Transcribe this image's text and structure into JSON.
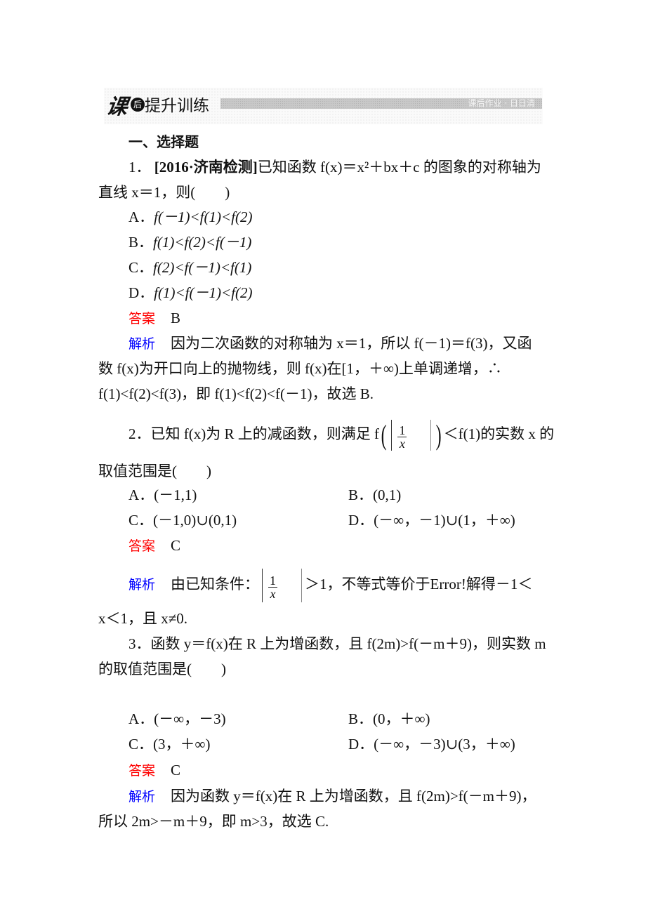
{
  "header": {
    "logo_char": "课",
    "badge_char": "后",
    "title": "提升训练",
    "subtitle": "课后作业 · 日日清"
  },
  "section_title": "一、选择题",
  "colors": {
    "answer_label": "#ff0000",
    "analysis_label": "#0000ff",
    "text": "#111111"
  },
  "questions": [
    {
      "number": "1．",
      "stem_line1_prefix": "[2016·济南检测]",
      "stem_line1_rest": "已知函数 f(x)＝x²＋bx＋c 的图象的对称轴为",
      "stem_line2": "直线 x＝1，则(　　)",
      "options": [
        {
          "label": "A．",
          "text": "f(－1)<f(1)<f(2)"
        },
        {
          "label": "B．",
          "text": "f(1)<f(2)<f(－1)"
        },
        {
          "label": "C．",
          "text": "f(2)<f(－1)<f(1)"
        },
        {
          "label": "D．",
          "text": "f(1)<f(－1)<f(2)"
        }
      ],
      "answer_label": "答案",
      "answer": "B",
      "analysis_label": "解析",
      "analysis": [
        "因为二次函数的对称轴为 x＝1，所以 f(－1)＝f(3)，又函",
        "数 f(x)为开口向上的抛物线，则 f(x)在[1，＋∞)上单调递增，∴",
        "f(1)<f(2)<f(3)，即 f(1)<f(2)<f(－1)，故选 B."
      ]
    },
    {
      "number": "2．",
      "stem_line1_a": "已知 f(x)为 R 上的减函数，则满足 f",
      "frac_num": "1",
      "frac_den": "x",
      "stem_line1_b": "＜f(1)的实数 x 的",
      "stem_line2": "取值范围是(　　)",
      "options": [
        {
          "label": "A．",
          "text": "(－1,1)"
        },
        {
          "label": "B．",
          "text": "(0,1)"
        },
        {
          "label": "C．",
          "text": "(－1,0)∪(0,1)"
        },
        {
          "label": "D．",
          "text": "(－∞，－1)∪(1，＋∞)"
        }
      ],
      "answer_label": "答案",
      "answer": "C",
      "analysis_label": "解析",
      "analysis_a": "由已知条件：",
      "analysis_b": "＞1，不等式等价于Error!解得－1＜",
      "analysis_line2": "x＜1，且 x≠0."
    },
    {
      "number": "3．",
      "stem_line1": "函数 y＝f(x)在 R 上为增函数，且 f(2m)>f(－m＋9)，则实数 m",
      "stem_line2": "的取值范围是(　　)",
      "options": [
        {
          "label": "A．",
          "text": "(－∞，－3)"
        },
        {
          "label": "B．",
          "text": "(0，＋∞)"
        },
        {
          "label": "C．",
          "text": "(3，＋∞)"
        },
        {
          "label": "D．",
          "text": "(－∞，－3)∪(3，＋∞)"
        }
      ],
      "answer_label": "答案",
      "answer": "C",
      "analysis_label": "解析",
      "analysis": [
        "因为函数 y＝f(x)在 R 上为增函数，且 f(2m)>f(－m＋9)，",
        "所以 2m>－m＋9，即 m>3，故选 C."
      ]
    }
  ]
}
